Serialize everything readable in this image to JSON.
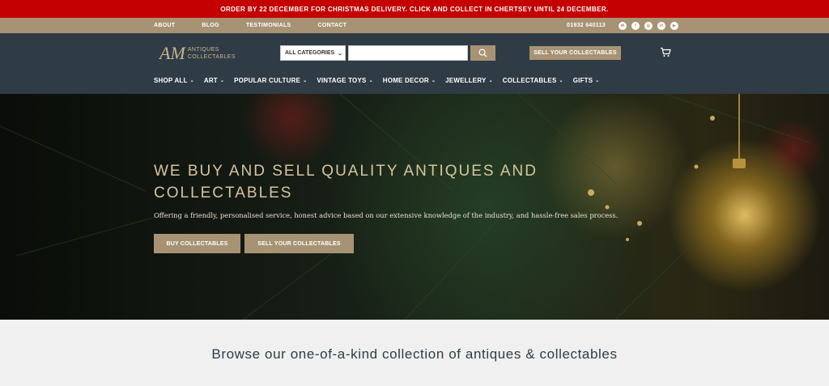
{
  "announcement": "ORDER BY 22 DECEMBER FOR CHRISTMAS DELIVERY. CLICK AND COLLECT IN CHERTSEY UNTIL 24 DECEMBER.",
  "utility": {
    "links": [
      "ABOUT",
      "BLOG",
      "TESTIMONIALS",
      "CONTACT"
    ],
    "phone": "01932 640113",
    "social": [
      "email-icon",
      "facebook-icon",
      "instagram-icon",
      "linkedin-icon",
      "youtube-icon"
    ]
  },
  "logo": {
    "mark": "AM",
    "line1": "ANTIQUES",
    "line2": "COLLECTABLES"
  },
  "search": {
    "category": "ALL CATEGORIES",
    "value": "",
    "placeholder": ""
  },
  "sell_button": "SELL YOUR COLLECTABLES",
  "nav": [
    "SHOP ALL",
    "ART",
    "POPULAR CULTURE",
    "VINTAGE TOYS",
    "HOME DECOR",
    "JEWELLERY",
    "COLLECTABLES",
    "GIFTS"
  ],
  "hero": {
    "title": "WE BUY AND SELL QUALITY ANTIQUES AND COLLECTABLES",
    "subtitle": "Offering a friendly, personalised service, honest advice based on our extensive knowledge of the industry, and hassle-free sales process.",
    "buy_button": "BUY COLLECTABLES",
    "sell_button": "SELL YOUR COLLECTABLES"
  },
  "browse_heading": "Browse our one-of-a-kind collection of antiques & collectables",
  "colors": {
    "announcement_bg": "#c40000",
    "utility_bg": "#a79373",
    "header_bg": "#2f3c45",
    "accent": "#a79373"
  }
}
